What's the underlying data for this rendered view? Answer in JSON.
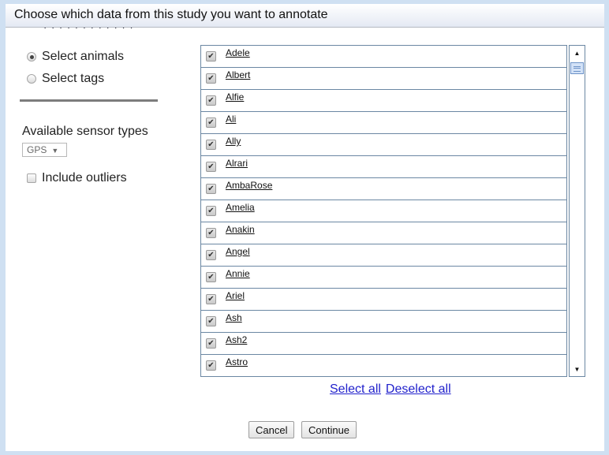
{
  "dialog": {
    "title": "Choose which data from this study you want to annotate",
    "clipped_text": "· · · · · · · · · · · ·"
  },
  "selection_mode": {
    "options": [
      {
        "label": "Select animals",
        "selected": true
      },
      {
        "label": "Select tags",
        "selected": false
      }
    ]
  },
  "sensor": {
    "label": "Available sensor types",
    "selected": "GPS",
    "arrow": "▼"
  },
  "outliers": {
    "label": "Include outliers",
    "checked": false
  },
  "animals": {
    "check_glyph": "✔",
    "items": [
      {
        "name": "Adele",
        "checked": true
      },
      {
        "name": "Albert",
        "checked": true
      },
      {
        "name": "Alfie",
        "checked": true
      },
      {
        "name": "Ali",
        "checked": true
      },
      {
        "name": "Ally",
        "checked": true
      },
      {
        "name": "Alrari",
        "checked": true
      },
      {
        "name": "AmbaRose",
        "checked": true
      },
      {
        "name": "Amelia",
        "checked": true
      },
      {
        "name": "Anakin",
        "checked": true
      },
      {
        "name": "Angel",
        "checked": true
      },
      {
        "name": "Annie",
        "checked": true
      },
      {
        "name": "Ariel",
        "checked": true
      },
      {
        "name": "Ash",
        "checked": true
      },
      {
        "name": "Ash2",
        "checked": true
      },
      {
        "name": "Astro",
        "checked": true
      }
    ]
  },
  "scrollbar": {
    "up": "▲",
    "down": "▼"
  },
  "links": {
    "select_all": "Select all",
    "deselect_all": "Deselect all"
  },
  "buttons": {
    "cancel": "Cancel",
    "continue": "Continue"
  }
}
